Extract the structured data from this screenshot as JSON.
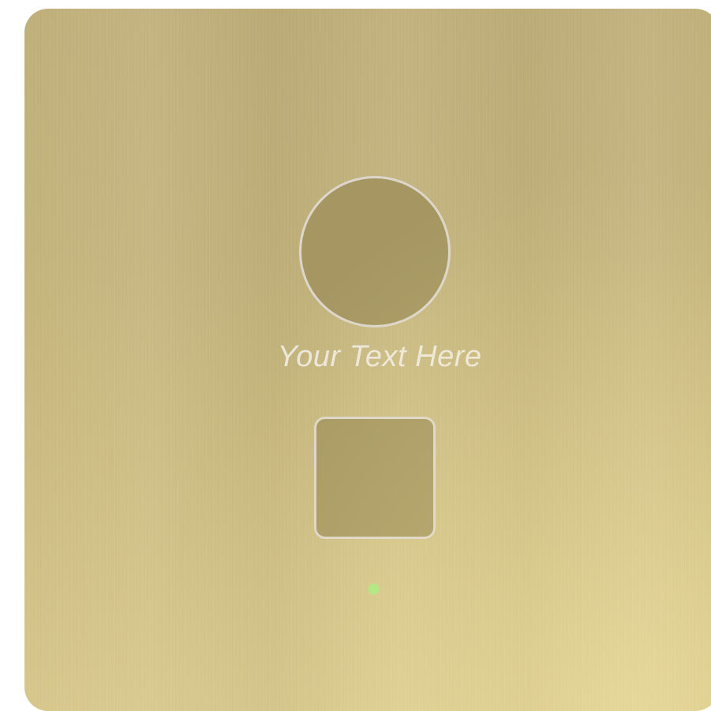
{
  "panel": {
    "caption": "Your Text Here",
    "circle_button_icon": "round-button",
    "square_button_icon": "square-button",
    "status_indicator": {
      "state": "on",
      "color": "#a7e77f"
    },
    "colors": {
      "surface": "#c4b47c",
      "button_fill": "#a69762",
      "button_border": "#dcd6cc",
      "caption_text": "#ece7dc"
    }
  }
}
